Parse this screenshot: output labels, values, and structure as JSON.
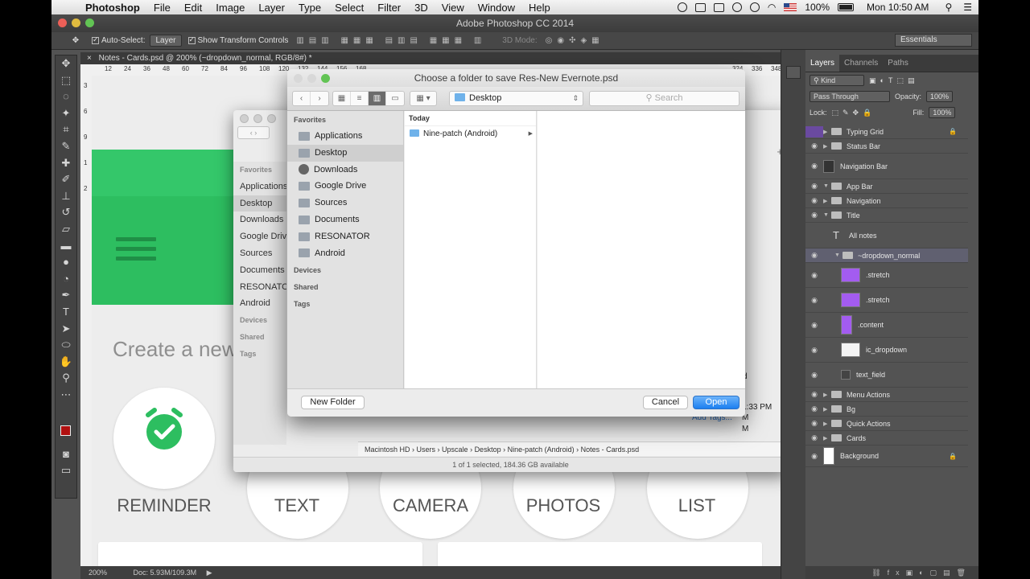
{
  "menubar": {
    "items": [
      "Photoshop",
      "File",
      "Edit",
      "Image",
      "Layer",
      "Type",
      "Select",
      "Filter",
      "3D",
      "View",
      "Window",
      "Help"
    ],
    "battery": "100%",
    "clock": "Mon 10:50 AM"
  },
  "app_title": "Adobe Photoshop CC 2014",
  "options": {
    "auto_select": "Auto-Select:",
    "auto_select_value": "Layer",
    "transform": "Show Transform Controls",
    "mode_3d": "3D Mode:",
    "workspace": "Essentials"
  },
  "document": {
    "tab_label": "Notes - Cards.psd @ 200% (~dropdown_normal, RGB/8#) *",
    "ruler_ticks": [
      "12",
      "24",
      "36",
      "48",
      "60",
      "72",
      "84",
      "96",
      "108",
      "120",
      "132",
      "144",
      "156",
      "168",
      "324",
      "336",
      "348"
    ],
    "ruler_v": [
      "3",
      "6",
      "9",
      "1",
      "2"
    ],
    "create_text": "Create a new",
    "actions": [
      "REMINDER",
      "TEXT",
      "CAMERA",
      "PHOTOS",
      "LIST"
    ],
    "zoom": "200%",
    "doc_size": "Doc: 5.93M/109.3M"
  },
  "finder_back": {
    "favorites_header": "Favorites",
    "favorites": [
      "Applications",
      "Desktop",
      "Downloads",
      "Google Drive",
      "Sources",
      "Documents",
      "RESONATOR",
      "Android"
    ],
    "devices": "Devices",
    "shared": "Shared",
    "tags": "Tags",
    "right_lines": [
      "1:33 PM",
      "M",
      "M"
    ],
    "right_d": "d",
    "add_tags": "Add Tags...",
    "path": [
      "Macintosh HD",
      "Users",
      "Upscale",
      "Desktop",
      "Nine-patch (Android)",
      "Notes - Cards.psd"
    ],
    "status": "1 of 1 selected, 184.36 GB available"
  },
  "dialog": {
    "title": "Choose a folder to save Res-New Evernote.psd",
    "location": "Desktop",
    "search_placeholder": "Search",
    "favorites_header": "Favorites",
    "favorites": [
      "Applications",
      "Desktop",
      "Downloads",
      "Google Drive",
      "Sources",
      "Documents",
      "RESONATOR",
      "Android"
    ],
    "devices": "Devices",
    "shared": "Shared",
    "tags": "Tags",
    "column_header": "Today",
    "column_items": [
      "Nine-patch (Android)"
    ],
    "new_folder": "New Folder",
    "cancel": "Cancel",
    "open": "Open"
  },
  "layers_panel": {
    "tabs": [
      "Layers",
      "Channels",
      "Paths"
    ],
    "kind": "Kind",
    "blend": "Pass Through",
    "opacity_label": "Opacity:",
    "opacity": "100%",
    "lock_label": "Lock:",
    "fill_label": "Fill:",
    "fill": "100%",
    "layers": [
      {
        "name": "Typing Grid"
      },
      {
        "name": "Status Bar"
      },
      {
        "name": "Navigation Bar"
      },
      {
        "name": "App Bar"
      },
      {
        "name": "Navigation"
      },
      {
        "name": "Title"
      },
      {
        "name": "All notes"
      },
      {
        "name": "~dropdown_normal"
      },
      {
        "name": ".stretch"
      },
      {
        "name": ".stretch"
      },
      {
        "name": ".content"
      },
      {
        "name": "ic_dropdown"
      },
      {
        "name": "text_field"
      },
      {
        "name": "Menu Actions"
      },
      {
        "name": "Bg"
      },
      {
        "name": "Quick Actions"
      },
      {
        "name": "Cards"
      },
      {
        "name": "Background"
      }
    ]
  },
  "colors": {
    "green": "#2dbe60",
    "accent_blue": "#1c7ff0",
    "selected_layer": "#606070"
  }
}
